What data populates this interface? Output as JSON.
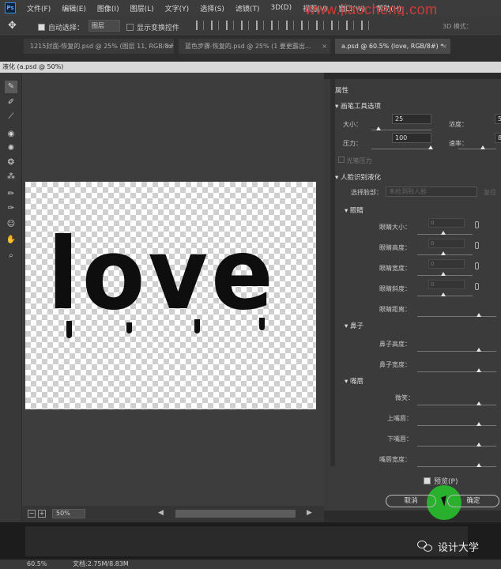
{
  "menubar": {
    "logo": "Ps",
    "items": [
      "文件(F)",
      "编辑(E)",
      "图像(I)",
      "图层(L)",
      "文字(Y)",
      "选择(S)",
      "滤镜(T)",
      "3D(D)",
      "视图(V)",
      "窗口(W)",
      "帮助(H)"
    ],
    "watermark": "www.jiaocheng.com"
  },
  "options": {
    "auto_select": "自动选择：",
    "layer_value": "图层",
    "show_transform": "显示变换控件",
    "mode_3d": "3D 模式："
  },
  "tabs": [
    {
      "label": "1215封面-恢复的.psd @ 25% (图层 11, RGB/8#) *"
    },
    {
      "label": "蓝色步骤-恢复的.psd @ 25% (1 要更露出..."
    },
    {
      "label": "a.psd @ 60.5% (love, RGB/8#) *"
    }
  ],
  "dialog": {
    "title": "液化 (a.psd @ 50%)"
  },
  "canvas": {
    "text": "love",
    "zoom": "50%"
  },
  "properties": {
    "header": "属性",
    "brush_section": "画笔工具选项",
    "size_label": "大小：",
    "size_value": "25",
    "density_label": "浓度：",
    "density_value": "50",
    "pressure_label": "压力：",
    "pressure_value": "100",
    "rate_label": "速率：",
    "rate_value": "80",
    "stylus_label": "光笔压力",
    "face_section": "人脸识别液化",
    "select_face_label": "选择脸部：",
    "select_face_value": "未检测到人脸",
    "reset_label": "复位",
    "eyes_section": "眼睛",
    "eye_size": "眼睛大小：",
    "eye_height": "眼睛高度：",
    "eye_width": "眼睛宽度：",
    "eye_tilt": "眼睛斜度：",
    "eye_distance": "眼睛距离：",
    "eye_value": "0",
    "nose_section": "鼻子",
    "nose_height": "鼻子高度：",
    "nose_width": "鼻子宽度：",
    "mouth_section": "嘴唇",
    "smile": "微笑：",
    "upper_lip": "上嘴唇：",
    "lower_lip": "下嘴唇：",
    "mouth_width": "嘴唇宽度：",
    "preview_label": "预览(P)",
    "cancel": "取消",
    "ok": "确定"
  },
  "status": {
    "zoom": "60.5%",
    "doc": "文档:2.75M/8.83M"
  },
  "brand": {
    "name": "设计大学"
  },
  "colors": {
    "accent_green": "#28b62c",
    "watermark_red": "#d23a3a"
  }
}
